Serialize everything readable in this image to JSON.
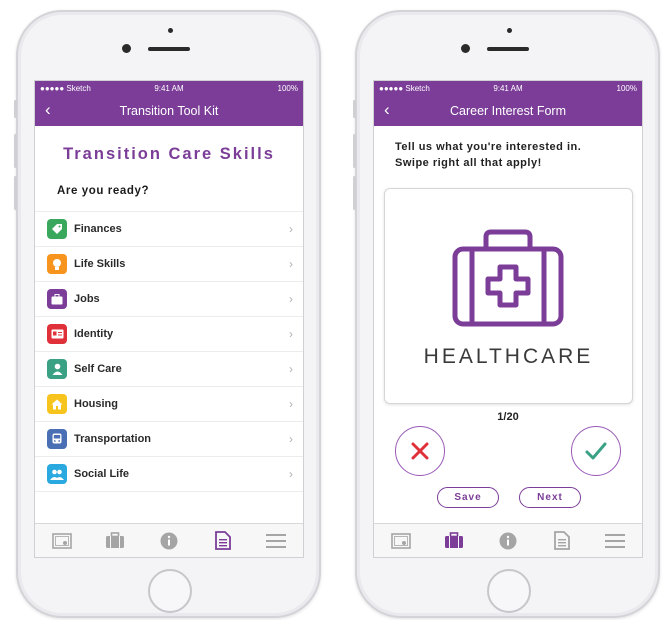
{
  "colors": {
    "accent": "#7b3d98",
    "reject": "#e0303a",
    "accept": "#3aa184"
  },
  "status_bar": {
    "carrier": "●●●●● Sketch",
    "time": "9:41 AM",
    "battery": "100%"
  },
  "left_screen": {
    "nav_title": "Transition Tool Kit",
    "heading": "Transition Care Skills",
    "subheading": "Are you ready?",
    "items": [
      {
        "label": "Finances",
        "icon": "tag-icon",
        "color": "#3aa85c"
      },
      {
        "label": "Life Skills",
        "icon": "lightbulb-icon",
        "color": "#f7941d"
      },
      {
        "label": "Jobs",
        "icon": "briefcase-icon",
        "color": "#7b3d98"
      },
      {
        "label": "Identity",
        "icon": "id-card-icon",
        "color": "#e0303a"
      },
      {
        "label": "Self Care",
        "icon": "person-icon",
        "color": "#3aa184"
      },
      {
        "label": "Housing",
        "icon": "house-icon",
        "color": "#f7c31d"
      },
      {
        "label": "Transportation",
        "icon": "bus-icon",
        "color": "#4a6fb5"
      },
      {
        "label": "Social Life",
        "icon": "people-icon",
        "color": "#29a9e0"
      }
    ],
    "active_tab": "document"
  },
  "right_screen": {
    "nav_title": "Career Interest Form",
    "intro_line1": "Tell us what you're interested in.",
    "intro_line2": "Swipe right all that apply!",
    "card_label": "HEALTHCARE",
    "card_icon": "medical-kit-icon",
    "counter": "1/20",
    "save_label": "Save",
    "next_label": "Next",
    "active_tab": "briefcase"
  },
  "tabs": [
    "certificate-icon",
    "briefcase-icon",
    "info-icon",
    "document-icon",
    "menu-icon"
  ]
}
